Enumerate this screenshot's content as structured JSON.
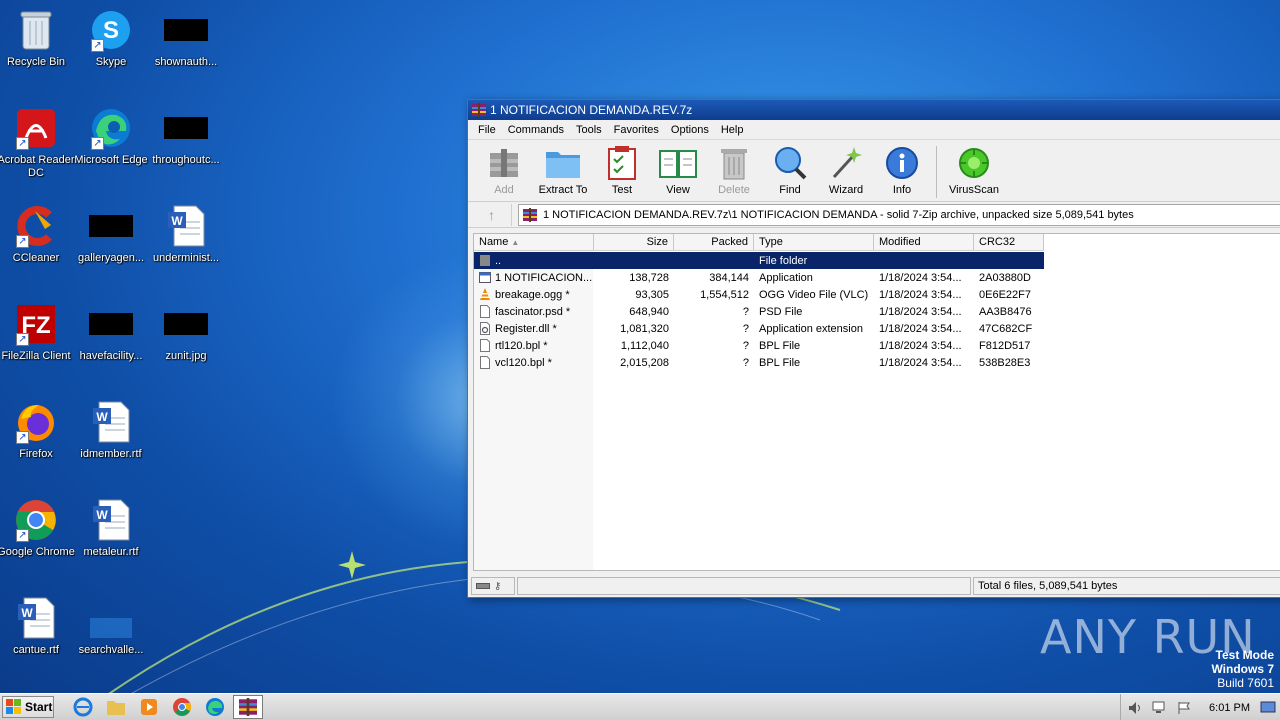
{
  "desktop": {
    "icons": [
      {
        "label": "Recycle Bin"
      },
      {
        "label": "Skype"
      },
      {
        "label": "shownauth..."
      },
      {
        "label": "Acrobat Reader DC"
      },
      {
        "label": "Microsoft Edge"
      },
      {
        "label": "throughoutc..."
      },
      {
        "label": "CCleaner"
      },
      {
        "label": "galleryagen..."
      },
      {
        "label": "underminist..."
      },
      {
        "label": "FileZilla Client"
      },
      {
        "label": "havefacility..."
      },
      {
        "label": "zunit.jpg"
      },
      {
        "label": "Firefox"
      },
      {
        "label": "idmember.rtf"
      },
      {
        "label": "Google Chrome"
      },
      {
        "label": "metaleur.rtf"
      },
      {
        "label": "cantue.rtf"
      },
      {
        "label": "searchvalle..."
      }
    ]
  },
  "window": {
    "title": "1 NOTIFICACION DEMANDA.REV.7z",
    "menu": [
      "File",
      "Commands",
      "Tools",
      "Favorites",
      "Options",
      "Help"
    ],
    "toolbar": [
      {
        "label": "Add",
        "icon": "add-icon"
      },
      {
        "label": "Extract To",
        "icon": "extract-icon"
      },
      {
        "label": "Test",
        "icon": "test-icon"
      },
      {
        "label": "View",
        "icon": "view-icon"
      },
      {
        "label": "Delete",
        "icon": "delete-icon"
      },
      {
        "label": "Find",
        "icon": "find-icon"
      },
      {
        "label": "Wizard",
        "icon": "wizard-icon"
      },
      {
        "label": "Info",
        "icon": "info-icon"
      },
      {
        "label": "VirusScan",
        "icon": "virusscan-icon"
      }
    ],
    "address": "1 NOTIFICACION DEMANDA.REV.7z\\1 NOTIFICACION DEMANDA - solid 7-Zip archive, unpacked size 5,089,541 bytes",
    "columns": [
      "Name",
      "Size",
      "Packed",
      "Type",
      "Modified",
      "CRC32"
    ],
    "rows": [
      {
        "name": "..",
        "size": "",
        "packed": "",
        "type": "File folder",
        "modified": "",
        "crc": ""
      },
      {
        "name": "1 NOTIFICACION...",
        "size": "138,728",
        "packed": "384,144",
        "type": "Application",
        "modified": "1/18/2024 3:54...",
        "crc": "2A03880D"
      },
      {
        "name": "breakage.ogg *",
        "size": "93,305",
        "packed": "1,554,512",
        "type": "OGG Video File (VLC)",
        "modified": "1/18/2024 3:54...",
        "crc": "0E6E22F7"
      },
      {
        "name": "fascinator.psd *",
        "size": "648,940",
        "packed": "?",
        "type": "PSD File",
        "modified": "1/18/2024 3:54...",
        "crc": "AA3B8476"
      },
      {
        "name": "Register.dll *",
        "size": "1,081,320",
        "packed": "?",
        "type": "Application extension",
        "modified": "1/18/2024 3:54...",
        "crc": "47C682CF"
      },
      {
        "name": "rtl120.bpl *",
        "size": "1,112,040",
        "packed": "?",
        "type": "BPL File",
        "modified": "1/18/2024 3:54...",
        "crc": "F812D517"
      },
      {
        "name": "vcl120.bpl *",
        "size": "2,015,208",
        "packed": "?",
        "type": "BPL File",
        "modified": "1/18/2024 3:54...",
        "crc": "538B28E3"
      }
    ],
    "status": "Total 6 files, 5,089,541 bytes"
  },
  "taskbar": {
    "start": "Start",
    "clock": "6:01 PM"
  },
  "watermark": "ANY RUN",
  "testmode": {
    "line1": "Test Mode",
    "line2": "Windows 7",
    "line3": "Build 7601"
  }
}
